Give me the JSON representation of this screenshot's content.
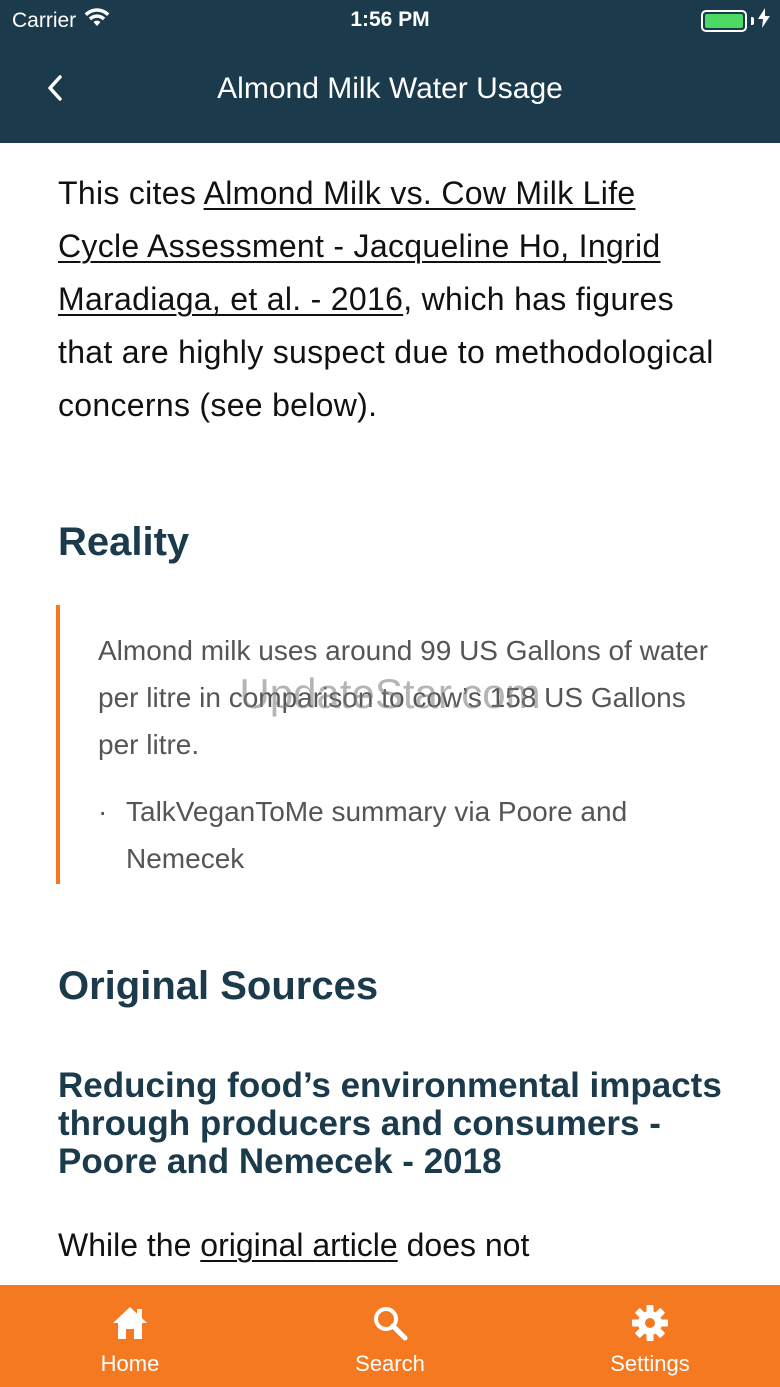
{
  "status_bar": {
    "carrier": "Carrier",
    "time": "1:56 PM"
  },
  "nav": {
    "title": "Almond Milk Water Usage",
    "back_icon": "chevron-left-icon"
  },
  "intro": {
    "prefix": "This cites ",
    "link_text": "Almond Milk vs. Cow Milk Life Cycle Assessment - Jacqueline Ho, Ingrid Maradiaga, et al. - 2016",
    "suffix": ", which has figures that are highly suspect due to methodological concerns (see below)."
  },
  "reality": {
    "heading": "Reality",
    "quote": "Almond milk uses around 99 US Gallons of water per litre in comparison to cow’s 158 US Gallons per litre.",
    "bullet": "·",
    "source": "TalkVeganToMe summary via Poore and Nemecek"
  },
  "sources": {
    "heading": "Original Sources",
    "subheading": "Reducing food’s environmental impacts through producers and consumers - Poore and Nemecek - 2018",
    "para_prefix": "While the ",
    "para_link": "original article",
    "para_suffix": " does not"
  },
  "watermark": "UpdateStar.com",
  "tabs": [
    {
      "label": "Home",
      "icon": "home-icon"
    },
    {
      "label": "Search",
      "icon": "search-icon"
    },
    {
      "label": "Settings",
      "icon": "gear-icon"
    }
  ],
  "colors": {
    "header_bg": "#1b3a4b",
    "accent": "#f47920",
    "battery": "#4cd964"
  }
}
